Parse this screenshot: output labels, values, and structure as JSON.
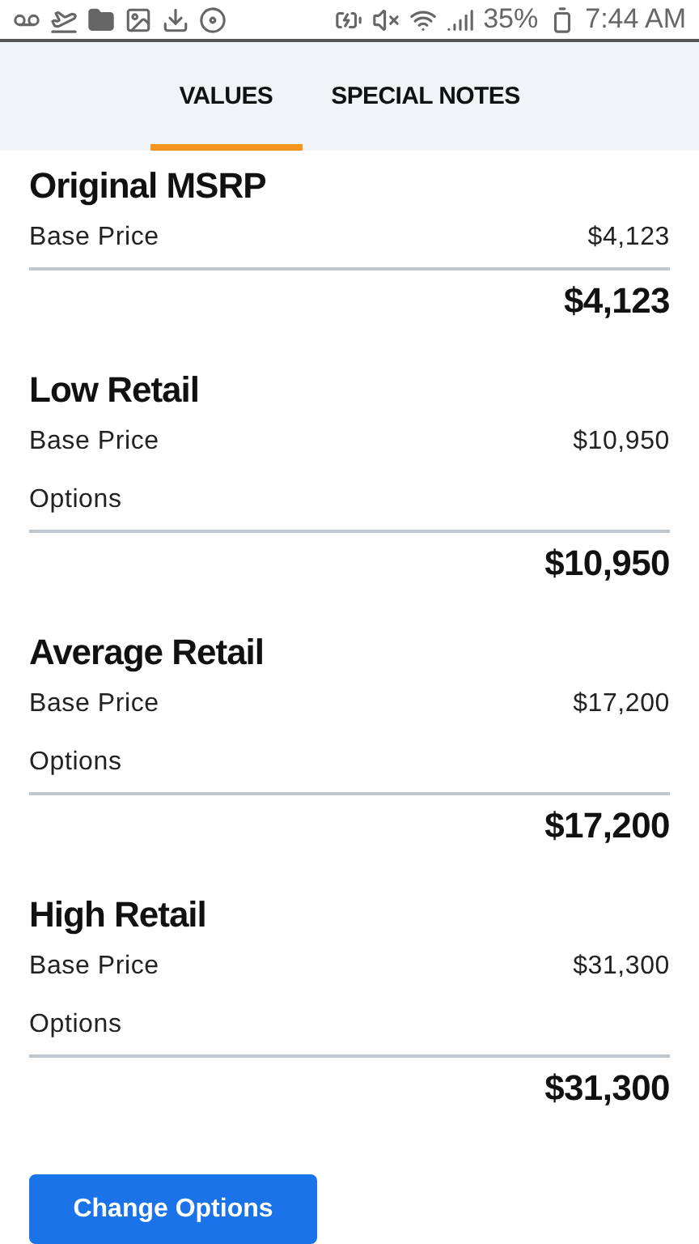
{
  "status_bar": {
    "battery_percent": "35%",
    "time": "7:44 AM"
  },
  "tabs": [
    {
      "label": "VALUES",
      "selected": true
    },
    {
      "label": "SPECIAL NOTES",
      "selected": false
    }
  ],
  "sections": [
    {
      "title": "Original MSRP",
      "rows": [
        {
          "label": "Base Price",
          "value": "$4,123"
        }
      ],
      "total": "$4,123"
    },
    {
      "title": "Low Retail",
      "rows": [
        {
          "label": "Base Price",
          "value": "$10,950"
        },
        {
          "label": "Options"
        }
      ],
      "total": "$10,950"
    },
    {
      "title": "Average Retail",
      "rows": [
        {
          "label": "Base Price",
          "value": "$17,200"
        },
        {
          "label": "Options"
        }
      ],
      "total": "$17,200"
    },
    {
      "title": "High Retail",
      "rows": [
        {
          "label": "Base Price",
          "value": "$31,300"
        },
        {
          "label": "Options"
        }
      ],
      "total": "$31,300"
    }
  ],
  "button": {
    "label": "Change Options"
  }
}
